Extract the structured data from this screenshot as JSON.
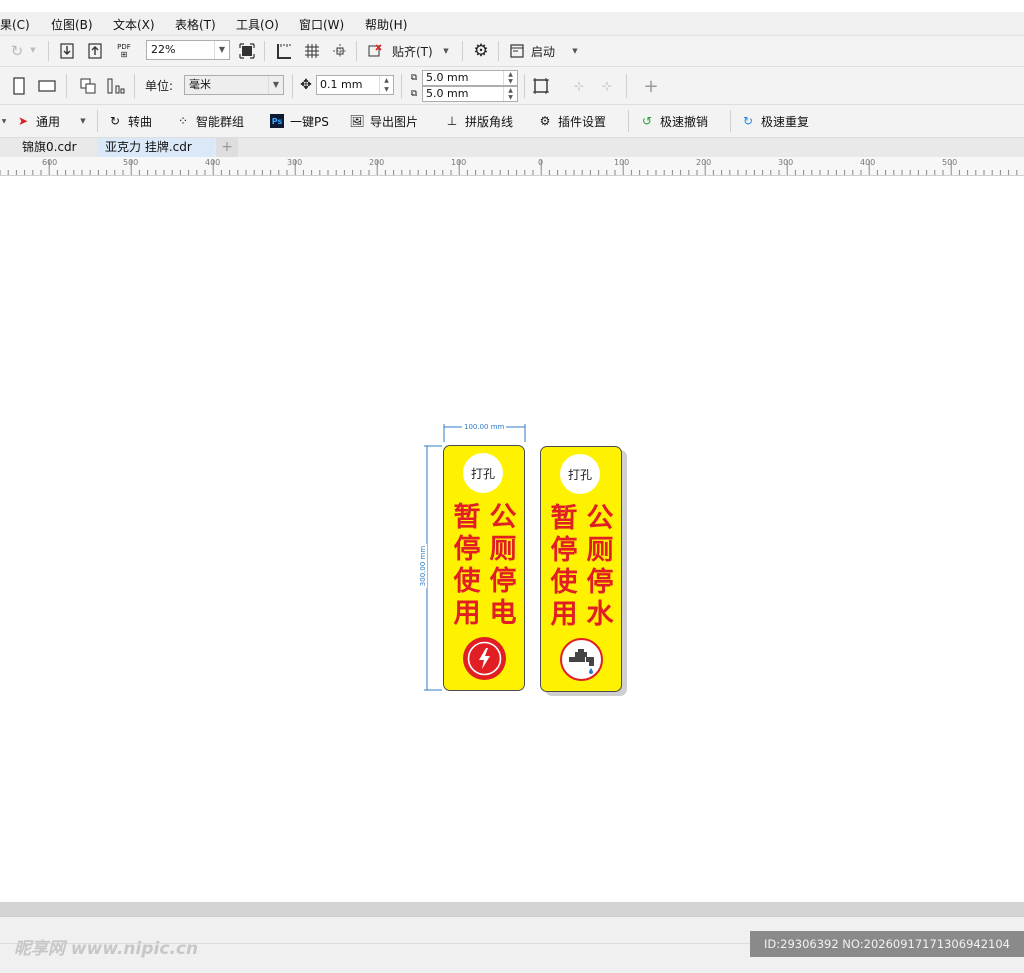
{
  "menu": {
    "items": [
      "果(C)",
      "位图(B)",
      "文本(X)",
      "表格(T)",
      "工具(O)",
      "窗口(W)",
      "帮助(H)"
    ]
  },
  "toolbar": {
    "pdf_label": "PDF",
    "zoom_value": "22%",
    "snap_label": "贴齐(T)",
    "launch_label": "启动"
  },
  "property_bar": {
    "unit_label": "单位:",
    "unit_value": "毫米",
    "nudge_value": "0.1 mm",
    "dup_x": "5.0 mm",
    "dup_y": "5.0 mm"
  },
  "plugin_bar": {
    "items": [
      "通用",
      "转曲",
      "智能群组",
      "一键PS",
      "导出图片",
      "拼版角线",
      "插件设置",
      "极速撤销",
      "极速重复"
    ]
  },
  "doc_tabs": {
    "tabs": [
      "锦旗0.cdr",
      "亚克力 挂牌.cdr"
    ],
    "add_label": "+"
  },
  "ruler": {
    "labels": [
      "600",
      "500",
      "400",
      "300",
      "200",
      "100",
      "0",
      "100",
      "200",
      "300",
      "400",
      "500"
    ]
  },
  "design": {
    "sign_color": "#fff200",
    "text_color": "#e01e24",
    "dim_color": "#2c7bc4",
    "width_dim": "100.00 mm",
    "height_dim": "300.00 mm",
    "sign1": {
      "hole_label": "打孔",
      "col_left": [
        "暂",
        "停",
        "使",
        "用"
      ],
      "col_right": [
        "公",
        "厕",
        "停",
        "电"
      ],
      "icon": "lightning-icon"
    },
    "sign2": {
      "hole_label": "打孔",
      "col_left": [
        "暂",
        "停",
        "使",
        "用"
      ],
      "col_right": [
        "公",
        "厕",
        "停",
        "水"
      ],
      "icon": "faucet-icon"
    }
  },
  "watermark": {
    "left_text": "昵享网 www.nipic.cn",
    "right_text": "ID:29306392 NO:20260917171306942104"
  }
}
